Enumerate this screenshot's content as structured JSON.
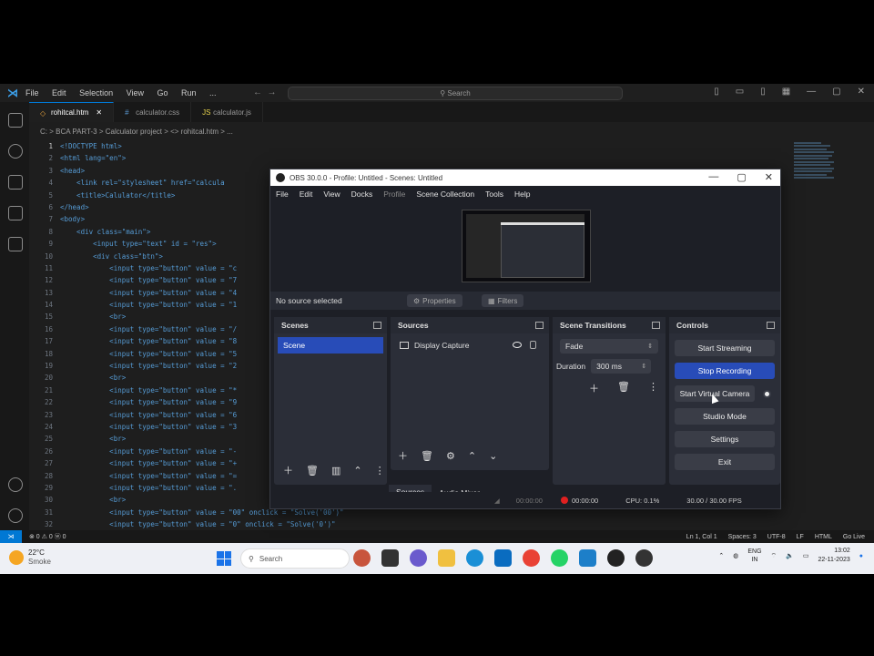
{
  "vscode": {
    "menu": [
      "File",
      "Edit",
      "Selection",
      "View",
      "Go",
      "Run",
      "..."
    ],
    "search_placeholder": "Search",
    "tabs": [
      {
        "label": "rohitcal.htm",
        "active": true
      },
      {
        "label": "calculator.css",
        "active": false
      },
      {
        "label": "calculator.js",
        "active": false
      }
    ],
    "breadcrumb": "C: > BCA PART-3 > Calculator project > <> rohitcal.htm > ...",
    "code_lines": [
      {
        "n": "1",
        "text": "<!DOCTYPE html>"
      },
      {
        "n": "2",
        "text": "<html lang=\"en\">"
      },
      {
        "n": "3",
        "text": "<head>"
      },
      {
        "n": "4",
        "text": "    <link rel=\"stylesheet\" href=\"calcula"
      },
      {
        "n": "5",
        "text": "    <title>Calulator</title>"
      },
      {
        "n": "6",
        "text": "</head>"
      },
      {
        "n": "7",
        "text": "<body>"
      },
      {
        "n": "8",
        "text": "    <div class=\"main\">"
      },
      {
        "n": "9",
        "text": "        <input type=\"text\" id = \"res\">"
      },
      {
        "n": "10",
        "text": "        <div class=\"btn\">"
      },
      {
        "n": "11",
        "text": "            <input type=\"button\" value = \"c"
      },
      {
        "n": "12",
        "text": "            <input type=\"button\" value = \"7"
      },
      {
        "n": "13",
        "text": "            <input type=\"button\" value = \"4"
      },
      {
        "n": "14",
        "text": "            <input type=\"button\" value = \"1"
      },
      {
        "n": "15",
        "text": "            <br>"
      },
      {
        "n": "16",
        "text": "            <input type=\"button\" value = \"/"
      },
      {
        "n": "17",
        "text": "            <input type=\"button\" value = \"8"
      },
      {
        "n": "18",
        "text": "            <input type=\"button\" value = \"5"
      },
      {
        "n": "19",
        "text": "            <input type=\"button\" value = \"2"
      },
      {
        "n": "20",
        "text": "            <br>"
      },
      {
        "n": "21",
        "text": "            <input type=\"button\" value = \"*"
      },
      {
        "n": "22",
        "text": "            <input type=\"button\" value = \"9"
      },
      {
        "n": "23",
        "text": "            <input type=\"button\" value = \"6"
      },
      {
        "n": "24",
        "text": "            <input type=\"button\" value = \"3"
      },
      {
        "n": "25",
        "text": "            <br>"
      },
      {
        "n": "26",
        "text": "            <input type=\"button\" value = \"-"
      },
      {
        "n": "27",
        "text": "            <input type=\"button\" value = \"+"
      },
      {
        "n": "28",
        "text": "            <input type=\"button\" value = \"="
      },
      {
        "n": "29",
        "text": "            <input type=\"button\" value = \"."
      },
      {
        "n": "30",
        "text": "            <br>"
      },
      {
        "n": "31",
        "text": "            <input type=\"button\" value = \"00\" onclick = \"Solve('00')\""
      },
      {
        "n": "32",
        "text": "            <input type=\"button\" value = \"0\" onclick = \"Solve('0')\""
      }
    ],
    "status": {
      "left": "⊗ 0 ⚠ 0   ⓦ 0",
      "right": [
        "Ln 1, Col 1",
        "Spaces: 3",
        "UTF-8",
        "LF",
        "HTML",
        "Go Live"
      ]
    }
  },
  "obs": {
    "title": "OBS 30.0.0 - Profile: Untitled - Scenes: Untitled",
    "menu": [
      "File",
      "Edit",
      "View",
      "Docks",
      "Profile",
      "Scene Collection",
      "Tools",
      "Help"
    ],
    "no_source": "No source selected",
    "properties_label": "Properties",
    "filters_label": "Filters",
    "scenes": {
      "header": "Scenes",
      "items": [
        "Scene"
      ]
    },
    "sources": {
      "header": "Sources",
      "items": [
        "Display Capture"
      ]
    },
    "dock_tabs": [
      "Sources",
      "Audio Mixer"
    ],
    "transitions": {
      "header": "Scene Transitions",
      "selected": "Fade",
      "duration_label": "Duration",
      "duration_value": "300 ms"
    },
    "controls": {
      "header": "Controls",
      "start_streaming": "Start Streaming",
      "stop_recording": "Stop Recording",
      "virtual_camera": "Start Virtual Camera",
      "studio_mode": "Studio Mode",
      "settings": "Settings",
      "exit": "Exit"
    },
    "status": {
      "stream_time": "00:00:00",
      "rec_time": "00:00:00",
      "cpu": "CPU: 0.1%",
      "fps": "30.00 / 30.00 FPS"
    }
  },
  "taskbar": {
    "weather_temp": "22°C",
    "weather_desc": "Smoke",
    "search_placeholder": "Search",
    "lang_1": "ENG",
    "lang_2": "IN",
    "time": "13:02",
    "date": "22-11-2023"
  },
  "colors": {
    "accent": "#284cb8",
    "record": "#e02020",
    "vscode_blue": "#0078d4"
  }
}
